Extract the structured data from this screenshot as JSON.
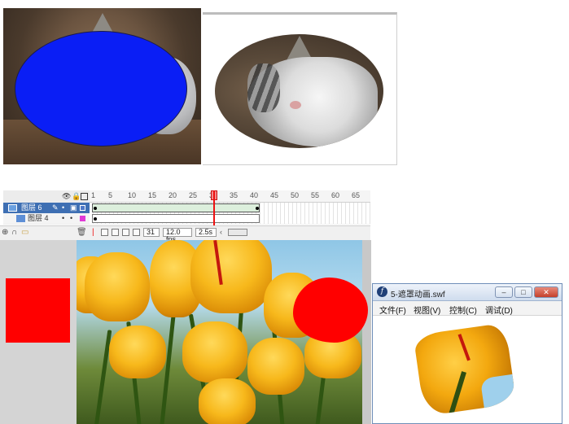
{
  "timeline": {
    "ruler_numbers": [
      "1",
      "5",
      "10",
      "15",
      "20",
      "25",
      "30",
      "35",
      "40",
      "45",
      "50",
      "55",
      "60",
      "65"
    ],
    "layers": [
      {
        "name": "图层 6",
        "selected": true
      },
      {
        "name": "图层 4",
        "selected": false
      }
    ],
    "current_frame": "31"
  },
  "status_bar": {
    "frame": "31",
    "fps": "12.0 fps",
    "time": "2.5s"
  },
  "swf_window": {
    "title": "5-遮罩动画.swf",
    "menu": [
      "文件(F)",
      "视图(V)",
      "控制(C)",
      "调试(D)"
    ],
    "minimize": "–",
    "maximize": "□",
    "close": "✕"
  },
  "colors": {
    "mask_blue": "#0a1ef5",
    "mask_red": "#ff0000",
    "playhead": "#ee1111"
  }
}
